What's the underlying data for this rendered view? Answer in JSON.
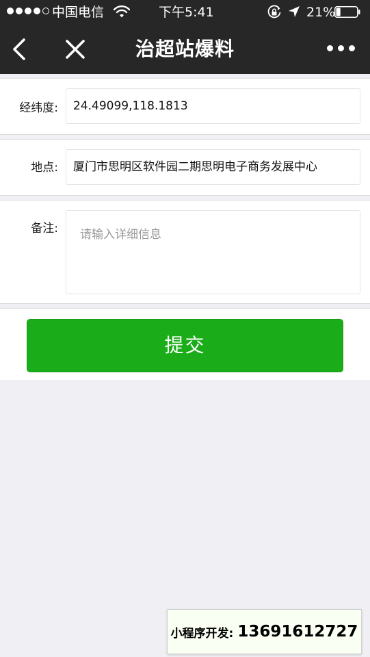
{
  "status_bar": {
    "carrier": "中国电信",
    "time": "下午5:41",
    "battery_percent": "21%",
    "battery_level": 0.21,
    "signal_bars_filled": 4,
    "signal_bars_total": 5,
    "icons": [
      "wifi-icon",
      "orientation-lock-icon",
      "location-arrow-icon",
      "battery-icon"
    ]
  },
  "nav": {
    "title": "治超站爆料",
    "icons": [
      "back-chevron-icon",
      "close-icon",
      "more-dots-icon"
    ]
  },
  "form": {
    "coords": {
      "label": "经纬度:",
      "value": "24.49099,118.1813"
    },
    "location": {
      "label": "地点:",
      "value": "厦门市思明区软件园二期思明电子商务发展中心"
    },
    "notes": {
      "label": "备注:",
      "placeholder": "请输入详细信息"
    }
  },
  "submit": {
    "label": "提交"
  },
  "banner": {
    "label": "小程序开发:",
    "phone": "13691612727"
  },
  "colors": {
    "statusbar_bg": "#272727",
    "page_bg": "#efeff4",
    "primary_green": "#1aad19",
    "banner_bg": "#fafff3"
  }
}
